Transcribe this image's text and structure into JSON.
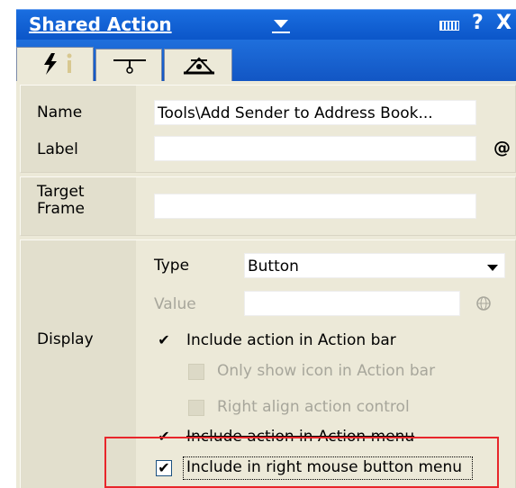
{
  "window": {
    "title": "Shared Action",
    "tabs": [
      {
        "name": "actions-tab",
        "active": true
      },
      {
        "name": "properties-tab",
        "active": false
      },
      {
        "name": "advanced-tab",
        "active": false
      }
    ]
  },
  "form": {
    "name_label": "Name",
    "name_value": "Tools\\Add Sender to Address Book...",
    "label_label": "Label",
    "label_value": "",
    "at_button": "@",
    "target_frame_label": "Target\nFrame",
    "target_frame_value": "",
    "display_label": "Display",
    "type_label": "Type",
    "type_value": "Button",
    "value_label": "Value",
    "value_value": "",
    "checkboxes": [
      {
        "label": "Include action in Action bar",
        "checked": true,
        "enabled": true
      },
      {
        "label": "Only show icon in Action bar",
        "checked": false,
        "enabled": false
      },
      {
        "label": "Right align action control",
        "checked": false,
        "enabled": false
      },
      {
        "label": "Include action in Action menu",
        "checked": true,
        "enabled": true
      },
      {
        "label": "Include in right mouse button menu",
        "checked": true,
        "enabled": true
      }
    ],
    "check_mark": "✔"
  },
  "colors": {
    "titlebar": "#1a6ee0",
    "panel": "#ece9d8",
    "highlight": "#e8262b"
  }
}
